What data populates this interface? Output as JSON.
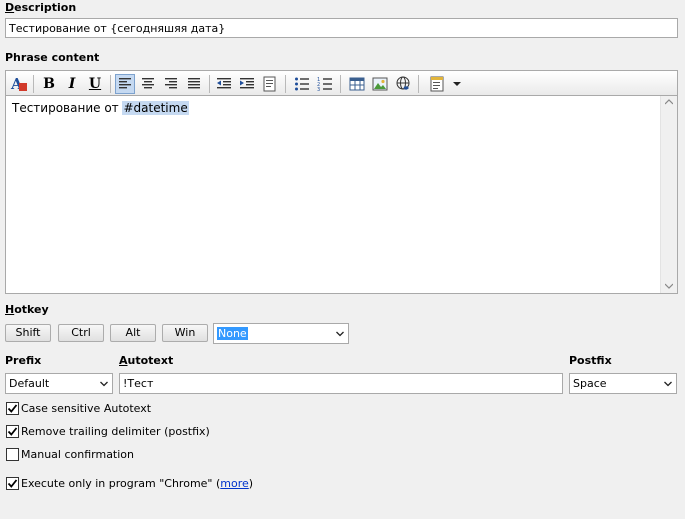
{
  "description": {
    "label": "Description",
    "value": "Тестирование от {сегодняшяя дата}"
  },
  "phrase": {
    "label": "Phrase content",
    "text": "Тестирование от ",
    "macro": "#datetime",
    "toolbar": {
      "bold": "B",
      "italic": "I",
      "underline": "U"
    }
  },
  "hotkey": {
    "label": "Hotkey",
    "modifiers": [
      "Shift",
      "Ctrl",
      "Alt",
      "Win"
    ],
    "key_value": "None"
  },
  "prefix": {
    "label": "Prefix",
    "value": "Default"
  },
  "autotext": {
    "label": "Autotext",
    "value": "!Тест"
  },
  "postfix": {
    "label": "Postfix",
    "value": "Space"
  },
  "options": {
    "case_sensitive": {
      "label": "Case sensitive Autotext",
      "checked": true
    },
    "remove_trailing": {
      "label": "Remove trailing delimiter (postfix)",
      "checked": true
    },
    "manual_confirm": {
      "label": "Manual confirmation",
      "checked": false
    },
    "execute_only": {
      "label": "Execute only in program \"Chrome\" (",
      "link": "more",
      "suffix": ")",
      "checked": true
    }
  },
  "colors": {
    "accent": "#3399ff",
    "macro_highlight": "#c5d9f1",
    "link": "#0033cc"
  }
}
